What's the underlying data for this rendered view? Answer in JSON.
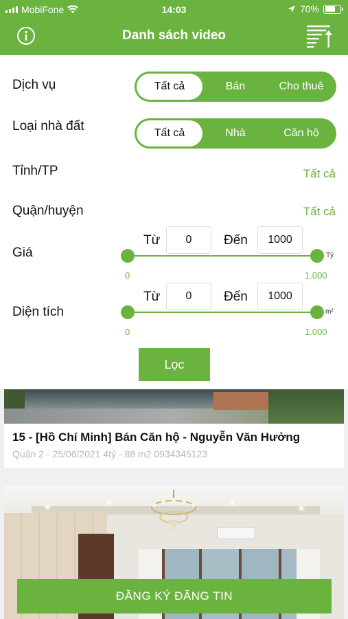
{
  "status_bar": {
    "carrier": "MobiFone",
    "time": "14:03",
    "battery_text": "70%",
    "battery_level": 0.7
  },
  "nav": {
    "title": "Danh sách video",
    "left_icon": "info-icon",
    "right_icon": "sort-icon"
  },
  "filters": {
    "service": {
      "label": "Dịch vụ",
      "options": [
        "Tất cả",
        "Bán",
        "Cho thuê"
      ],
      "selected": 0
    },
    "property_type": {
      "label": "Loại nhà đất",
      "options": [
        "Tất cả",
        "Nhà",
        "Căn hộ"
      ],
      "selected": 0
    },
    "province": {
      "label": "Tỉnh/TP",
      "value": "Tất cả"
    },
    "district": {
      "label": "Quận/huyện",
      "value": "Tất cả"
    },
    "price": {
      "label": "Giá",
      "from_label": "Từ",
      "to_label": "Đến",
      "from_value": "0",
      "to_value": "1000",
      "min_label": "0",
      "max_label": "1.000",
      "unit": "Tỷ"
    },
    "area": {
      "label": "Diện tích",
      "from_label": "Từ",
      "to_label": "Đến",
      "from_value": "0",
      "to_value": "1000",
      "min_label": "0",
      "max_label": "1.000",
      "unit": "m²"
    },
    "filter_button": "Lọc"
  },
  "videos": [
    {
      "title": "15 - [Hồ Chí Minh] Bán Căn hộ - Nguyễn Văn Hưởng",
      "subtitle": "Quận 2 - 25/06/2021  4tỷ - 88 m2 0934345123"
    }
  ],
  "register_button": "ĐĂNG KÝ ĐĂNG TIN",
  "colors": {
    "accent": "#6bb33f",
    "muted_text": "#b8b8b8"
  }
}
